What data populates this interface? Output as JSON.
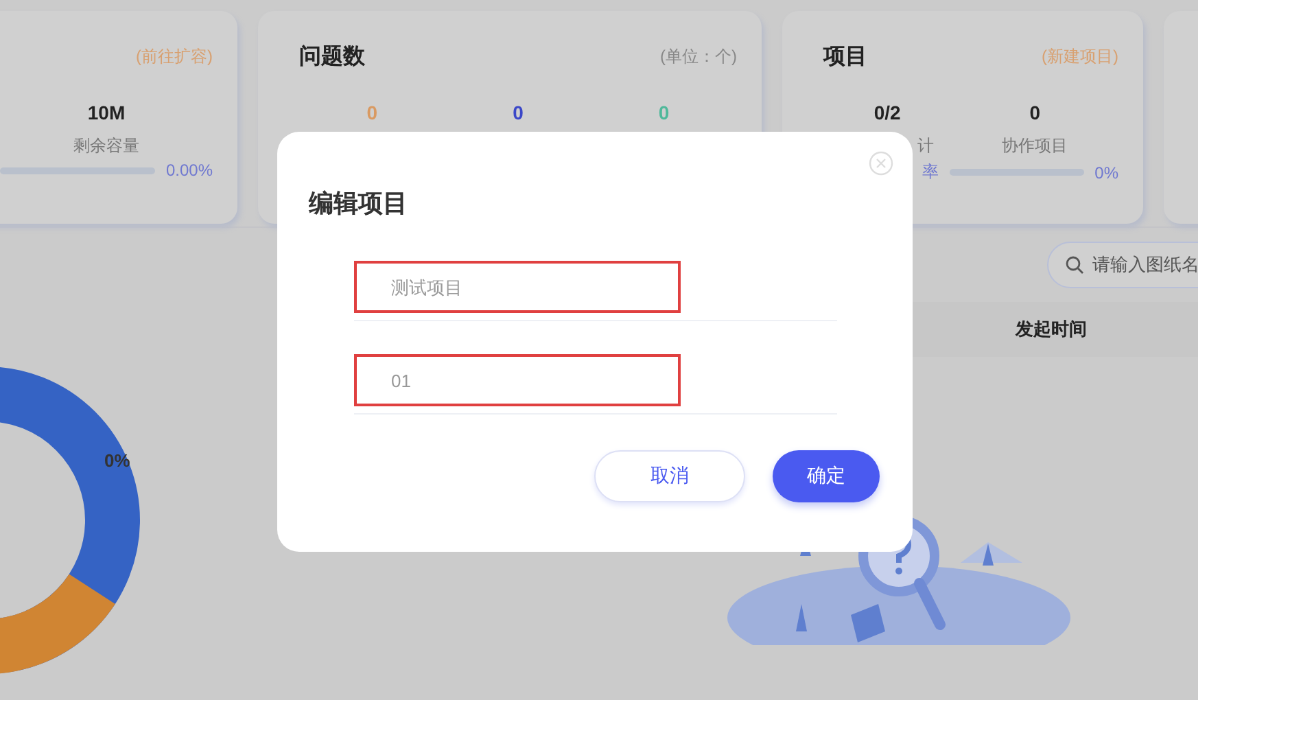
{
  "cards": [
    {
      "kind": "storage",
      "action": "(前往扩容)",
      "stats": [
        {
          "value": "10M",
          "label": "剩余容量"
        }
      ],
      "progress": {
        "level": 0,
        "reading": "0.00%"
      }
    },
    {
      "kind": "issues",
      "title": "问题数",
      "action": "(单位：个)",
      "stats": [
        {
          "value": "0",
          "color": "#d99a62"
        },
        {
          "value": "0",
          "color": "#3b47c8"
        },
        {
          "value": "0",
          "color": "#4fb89a"
        }
      ]
    },
    {
      "kind": "projects",
      "title": "项目",
      "action": "(新建项目)",
      "stats": [
        {
          "value": "0/2",
          "label": "计"
        },
        {
          "value": "0",
          "label": "协作项目"
        }
      ],
      "progress": {
        "label": "率",
        "level": 0,
        "reading": "0%"
      }
    },
    {
      "kind": "blank"
    }
  ],
  "donut": {
    "label": "0%"
  },
  "search": {
    "placeholder": "请输入图纸名"
  },
  "table": {
    "columns": [
      "发起时间"
    ]
  },
  "dialog": {
    "title": "编辑项目",
    "fields": [
      {
        "placeholder": "测试项目",
        "highlighted": true
      },
      {
        "placeholder": "01",
        "highlighted": true
      }
    ],
    "buttons": [
      {
        "label": "取消",
        "kind": "secondary"
      },
      {
        "label": "确定",
        "kind": "primary"
      }
    ]
  }
}
